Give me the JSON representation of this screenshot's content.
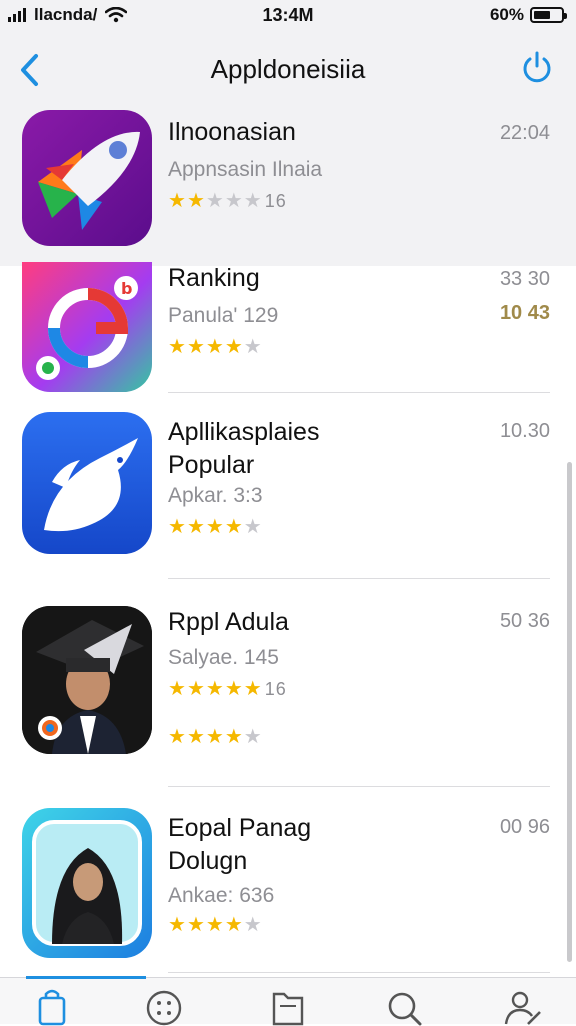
{
  "status_bar": {
    "carrier": "llacnda/",
    "time": "13:4M",
    "battery": "60%",
    "battery_level": 0.6
  },
  "nav": {
    "title": "Appldoneisiia",
    "back_icon": "chevron-left-icon",
    "share_icon": "power-icon"
  },
  "apps": [
    {
      "name_lines": [
        "Ilnoonasian"
      ],
      "subtitle": "Appnsasin Ilnaia",
      "rating_stars": 2,
      "rating_count": "16",
      "meta": "22:04",
      "meta2": ""
    },
    {
      "name_lines": [
        "Ranking"
      ],
      "subtitle": "Panula' 129",
      "rating_stars": 4,
      "rating_count": "",
      "meta": "33 30",
      "meta2": "10 43"
    },
    {
      "name_lines": [
        "Apllikasplaies",
        "Popular"
      ],
      "subtitle": "Apkar. 3:3",
      "rating_stars": 4,
      "rating_count": "",
      "meta": "10.30",
      "meta2": ""
    },
    {
      "name_lines": [
        "Rppl Adula"
      ],
      "subtitle": "Salyae. 145",
      "rating_stars": 5,
      "rating_count": "16",
      "rating2_stars": 4,
      "meta": "50 36",
      "meta2": ""
    },
    {
      "name_lines": [
        "Eopal Panag",
        "Dolugn"
      ],
      "subtitle": "Ankae: 636",
      "rating_stars": 4,
      "rating_count": "",
      "meta": "00 96",
      "meta2": ""
    }
  ],
  "tabs": [
    {
      "icon": "bag-icon",
      "active": true
    },
    {
      "icon": "grid-circle-icon",
      "active": false
    },
    {
      "icon": "folder-icon",
      "active": false
    },
    {
      "icon": "search-icon",
      "active": false
    },
    {
      "icon": "profile-edit-icon",
      "active": false
    }
  ],
  "colors": {
    "accent": "#1e8fe0",
    "star": "#f5b800",
    "header_bg": "#f2f2f4"
  }
}
